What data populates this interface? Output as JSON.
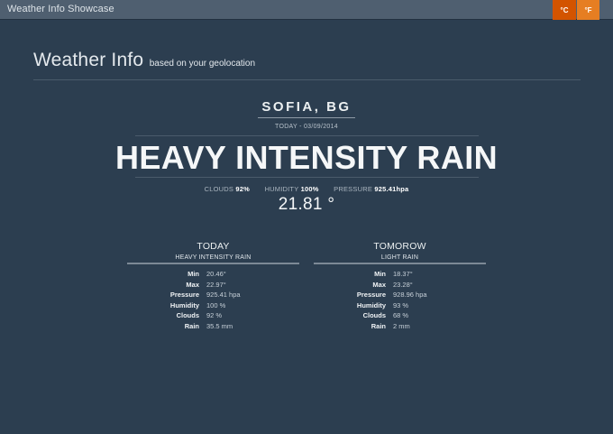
{
  "app": {
    "title": "Weather Info Showcase"
  },
  "units": {
    "celsius": "°C",
    "fahrenheit": "°F"
  },
  "heading": {
    "main": "Weather Info",
    "sub": "based on your geolocation"
  },
  "current": {
    "city": "SOFIA, BG",
    "date": "TODAY - 03/09/2014",
    "condition": "HEAVY INTENSITY RAIN",
    "metrics": {
      "clouds_label": "CLOUDS",
      "clouds_value": "92%",
      "humidity_label": "HUMIDITY",
      "humidity_value": "100%",
      "pressure_label": "PRESSURE",
      "pressure_value": "925.41hpa"
    },
    "temperature": "21.81 °"
  },
  "forecast": [
    {
      "title": "TODAY",
      "condition": "HEAVY INTENSITY RAIN",
      "rows": [
        {
          "label": "Min",
          "value": "20.46°"
        },
        {
          "label": "Max",
          "value": "22.97°"
        },
        {
          "label": "Pressure",
          "value": "925.41 hpa"
        },
        {
          "label": "Humidity",
          "value": "100 %"
        },
        {
          "label": "Clouds",
          "value": "92 %"
        },
        {
          "label": "Rain",
          "value": "35.5 mm"
        }
      ]
    },
    {
      "title": "TOMOROW",
      "condition": "LIGHT RAIN",
      "rows": [
        {
          "label": "Min",
          "value": "18.37°"
        },
        {
          "label": "Max",
          "value": "23.28°"
        },
        {
          "label": "Pressure",
          "value": "928.96 hpa"
        },
        {
          "label": "Humidity",
          "value": "93 %"
        },
        {
          "label": "Clouds",
          "value": "68 %"
        },
        {
          "label": "Rain",
          "value": "2 mm"
        }
      ]
    }
  ]
}
